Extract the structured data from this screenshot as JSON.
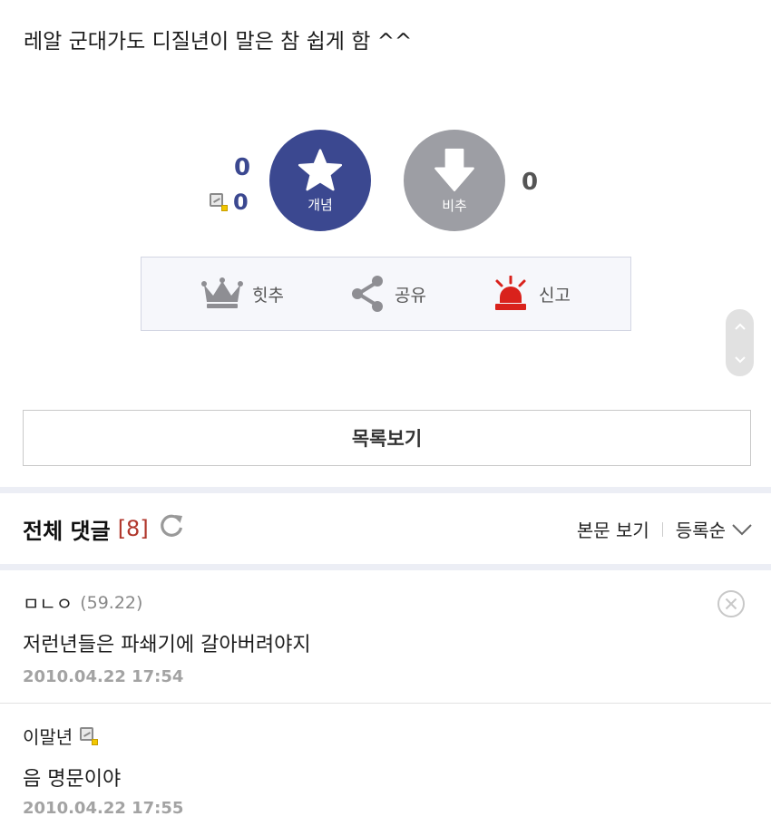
{
  "post": {
    "body": "레알 군대가도 디질년이 말은 참 쉽게 함 ^^"
  },
  "vote": {
    "up_count": "0",
    "fix_count": "0",
    "up_label": "개념",
    "down_label": "비추",
    "down_count": "0"
  },
  "actions": [
    {
      "label": "힛추",
      "icon": "crown-icon"
    },
    {
      "label": "공유",
      "icon": "share-icon"
    },
    {
      "label": "신고",
      "icon": "siren-icon"
    }
  ],
  "list_button": {
    "label": "목록보기"
  },
  "comments_header": {
    "title": "전체 댓글",
    "count": "[8]",
    "view_body": "본문 보기",
    "sort_label": "등록순"
  },
  "comments": [
    {
      "author": "ㅁㄴㅇ",
      "ip": "(59.22)",
      "text": "저런년들은 파쇄기에 갈아버려야지",
      "date": "2010.04.22 17:54"
    },
    {
      "author": "이말년",
      "text": "음 명문이야",
      "date": "2010.04.22 17:55"
    }
  ],
  "colors": {
    "brand": "#3b4890",
    "down": "#9d9ea4",
    "alert": "#d9221c",
    "count_red": "#b0372c"
  }
}
